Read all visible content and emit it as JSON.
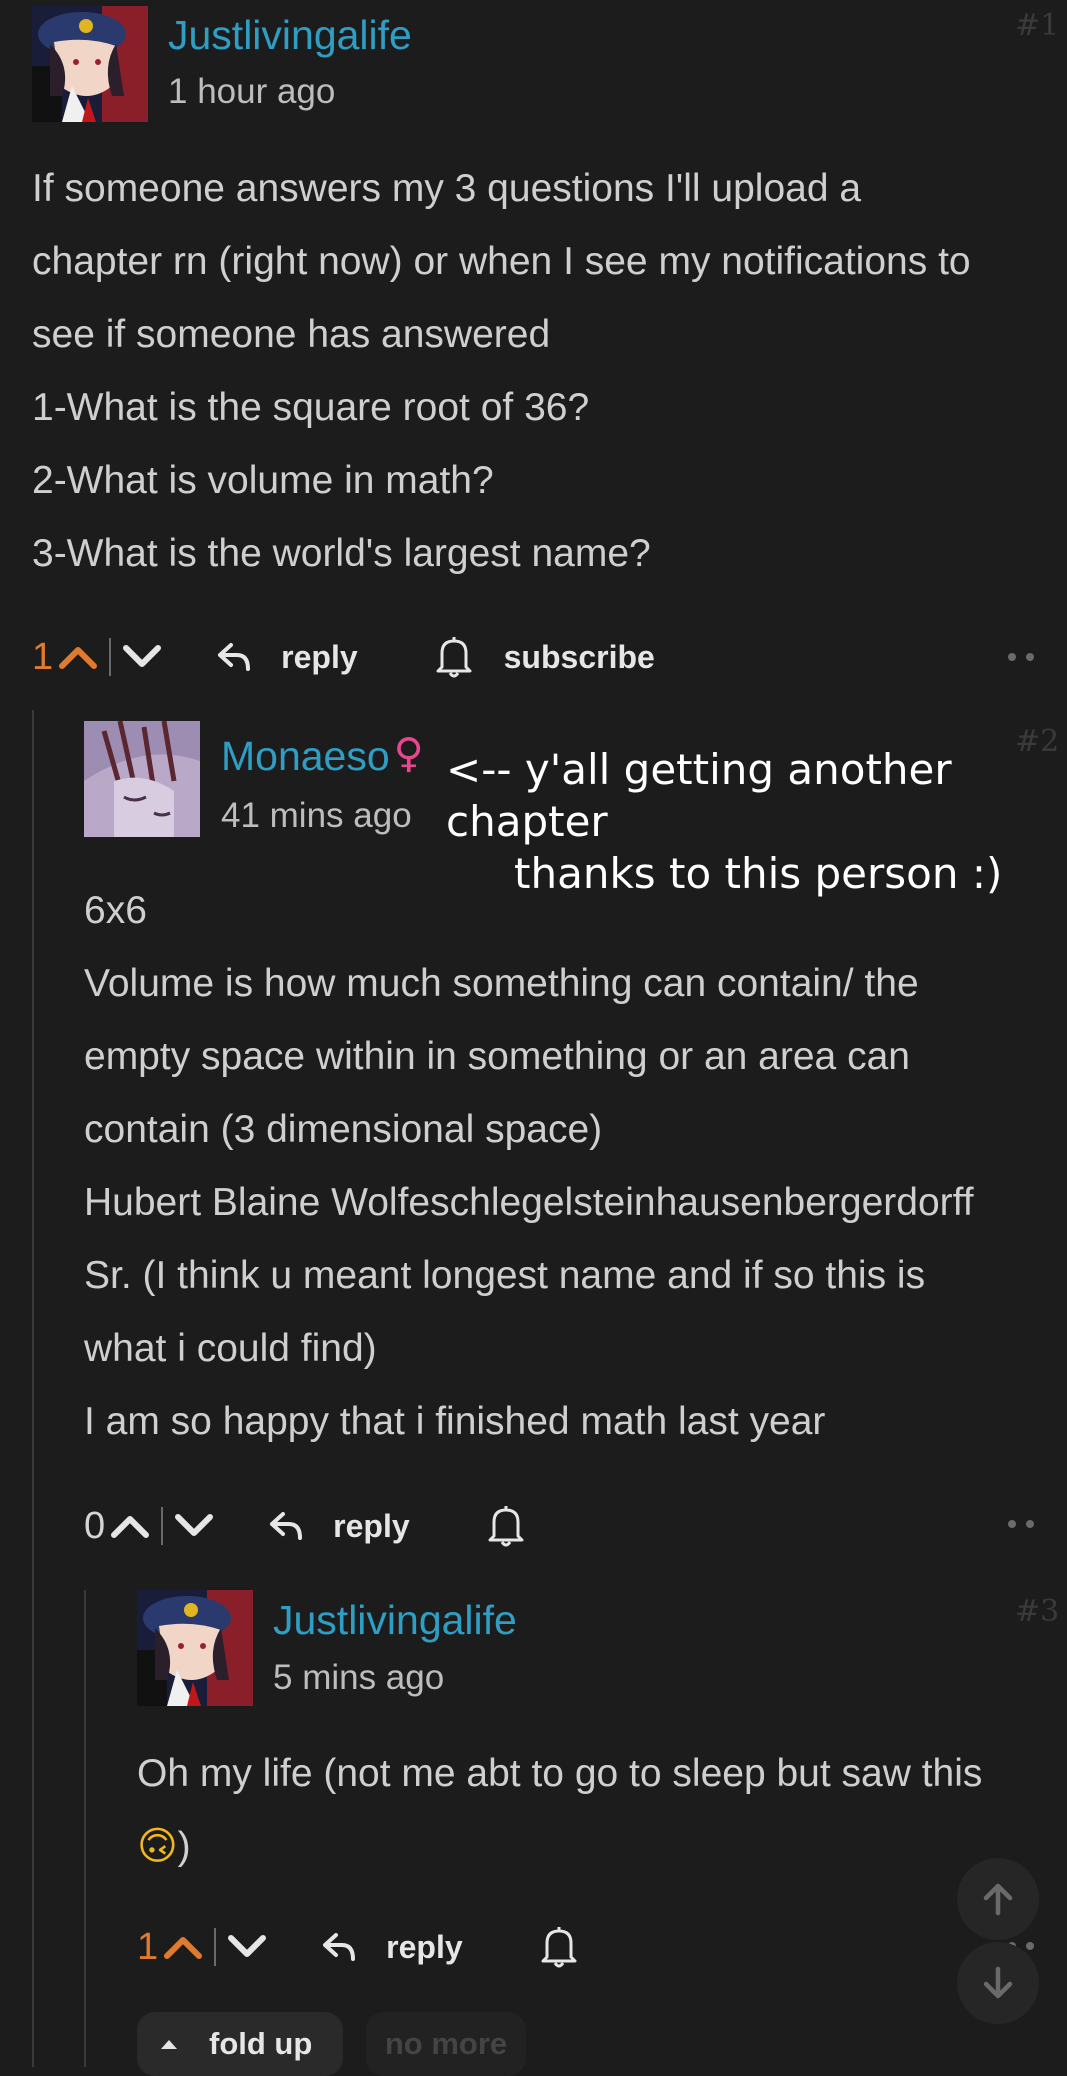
{
  "comments": [
    {
      "username": "Justlivingalife",
      "time": "1 hour ago",
      "index": "#1",
      "body": [
        "If someone answers my 3 questions I'll upload a",
        "chapter rn (right now) or when I see my notifications to",
        "see if someone has answered",
        "1-What is the square root of 36?",
        "2-What is volume in math?",
        "3-What is the world's largest name?"
      ],
      "score": "1",
      "reply_label": "reply",
      "subscribe_label": "subscribe"
    },
    {
      "username": "Monaeso",
      "gender_symbol": "♀",
      "time": "41 mins ago",
      "index": "#2",
      "annotation_line1": "<-- y'all getting another chapter",
      "annotation_line2": "thanks to this person :)",
      "body": [
        "6x6",
        "Volume is how much something can contain/ the",
        "empty space within in something or an area can",
        "contain (3 dimensional space)",
        "Hubert Blaine Wolfeschlegelsteinhausenbergerdorff",
        "Sr. (I think u meant longest name and if so this is",
        "what i could find)",
        "I am so happy that i finished math last year"
      ],
      "score": "0",
      "reply_label": "reply"
    },
    {
      "username": "Justlivingalife",
      "time": "5 mins ago",
      "index": "#3",
      "body": [
        "Oh my life (not me abt to go to sleep but saw this",
        ")"
      ],
      "emoji": "🙃",
      "score": "1",
      "reply_label": "reply"
    }
  ],
  "fold_up_label": "fold up",
  "no_more_label": "no more",
  "colors": {
    "username": "#2f9ec4",
    "score_hot": "#e07a2f",
    "gender": "#e8468f",
    "background": "#1c1c1c"
  },
  "icons": [
    "upvote-icon",
    "downvote-icon",
    "reply-icon",
    "bell-icon",
    "more-icon",
    "arrow-up-icon",
    "arrow-down-icon",
    "caret-up-icon"
  ]
}
